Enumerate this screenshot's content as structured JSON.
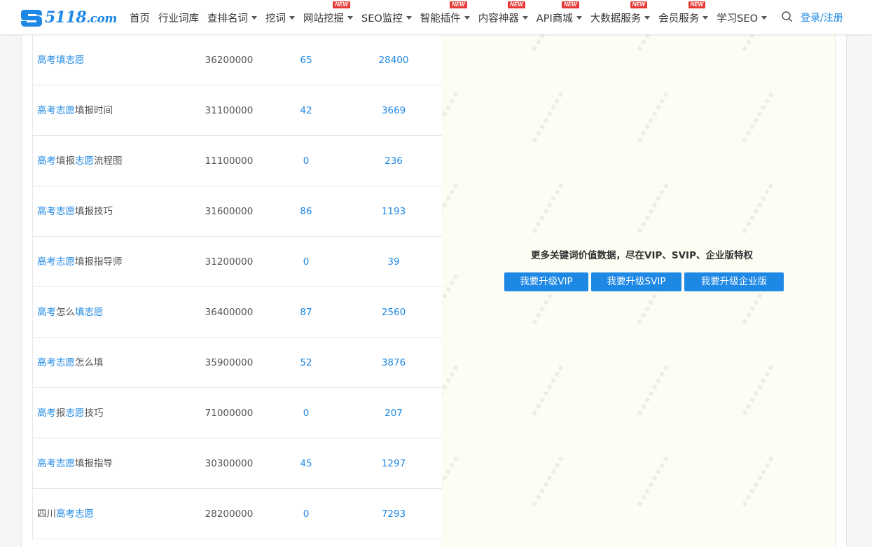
{
  "header": {
    "logo_text": "5118",
    "logo_suffix": ".com",
    "nav": [
      {
        "label": "首页",
        "dropdown": false,
        "new": false
      },
      {
        "label": "行业词库",
        "dropdown": false,
        "new": false
      },
      {
        "label": "查排名词",
        "dropdown": true,
        "new": false
      },
      {
        "label": "挖词",
        "dropdown": true,
        "new": false
      },
      {
        "label": "网站挖掘",
        "dropdown": true,
        "new": true
      },
      {
        "label": "SEO监控",
        "dropdown": true,
        "new": false
      },
      {
        "label": "智能插件",
        "dropdown": true,
        "new": true
      },
      {
        "label": "内容神器",
        "dropdown": true,
        "new": true
      },
      {
        "label": "API商城",
        "dropdown": true,
        "new": true
      },
      {
        "label": "大数据服务",
        "dropdown": true,
        "new": true
      },
      {
        "label": "会员服务",
        "dropdown": true,
        "new": true
      },
      {
        "label": "学习SEO",
        "dropdown": true,
        "new": false
      }
    ],
    "new_badge": "NEW",
    "login_label": "登录/注册"
  },
  "table": {
    "rows": [
      {
        "kw_parts": [
          [
            "高考填志愿",
            true
          ]
        ],
        "index": "36200000",
        "competition": "65",
        "results": "28400"
      },
      {
        "kw_parts": [
          [
            "高考志愿",
            true
          ],
          [
            "填报时间",
            false
          ]
        ],
        "index": "31100000",
        "competition": "42",
        "results": "3669"
      },
      {
        "kw_parts": [
          [
            "高考",
            true
          ],
          [
            "填报",
            false
          ],
          [
            "志愿",
            true
          ],
          [
            "流程图",
            false
          ]
        ],
        "index": "11100000",
        "competition": "0",
        "results": "236"
      },
      {
        "kw_parts": [
          [
            "高考志愿",
            true
          ],
          [
            "填报技巧",
            false
          ]
        ],
        "index": "31600000",
        "competition": "86",
        "results": "1193"
      },
      {
        "kw_parts": [
          [
            "高考志愿",
            true
          ],
          [
            "填报指导师",
            false
          ]
        ],
        "index": "31200000",
        "competition": "0",
        "results": "39"
      },
      {
        "kw_parts": [
          [
            "高考",
            true
          ],
          [
            "怎么",
            false
          ],
          [
            "填志愿",
            true
          ]
        ],
        "index": "36400000",
        "competition": "87",
        "results": "2560"
      },
      {
        "kw_parts": [
          [
            "高考志愿",
            true
          ],
          [
            "怎么填",
            false
          ]
        ],
        "index": "35900000",
        "competition": "52",
        "results": "3876"
      },
      {
        "kw_parts": [
          [
            "高考",
            true
          ],
          [
            "报",
            false
          ],
          [
            "志愿",
            true
          ],
          [
            "技巧",
            false
          ]
        ],
        "index": "71000000",
        "competition": "0",
        "results": "207"
      },
      {
        "kw_parts": [
          [
            "高考志愿",
            true
          ],
          [
            "填报指导",
            false
          ]
        ],
        "index": "30300000",
        "competition": "45",
        "results": "1297"
      },
      {
        "kw_parts": [
          [
            "四川",
            false
          ],
          [
            "高考志愿",
            true
          ]
        ],
        "index": "28200000",
        "competition": "0",
        "results": "7293"
      }
    ]
  },
  "vip": {
    "message": "更多关键词价值数据，尽在VIP、SVIP、企业版特权",
    "buttons": [
      "我要升级VIP",
      "我要升级SVIP",
      "我要升级企业版"
    ]
  },
  "colors": {
    "accent": "#1e88e5",
    "badge": "#e53935",
    "overlay_bg": "#fdfdf4"
  }
}
